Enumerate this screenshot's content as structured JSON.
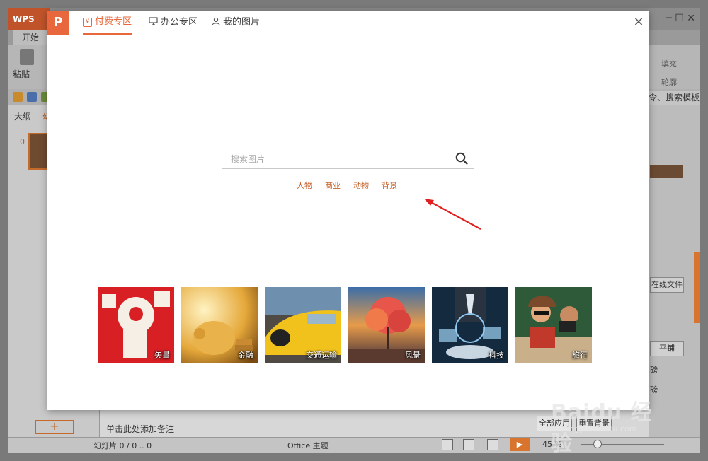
{
  "app": {
    "logo": "WPS",
    "tab_start": "开始",
    "paste_label": "粘贴",
    "left_tab_outline": "大纲",
    "left_tab_slide": "幻",
    "slide_num": "0",
    "add_slide": "+",
    "notes_placeholder": "单击此处添加备注",
    "status_slide": "幻灯片 0 / 0 .. 0",
    "status_theme": "Office 主题",
    "zoom": "45 %",
    "right_fill": "填充",
    "right_outline": "轮廓",
    "right_search_template": "令、搜索模板",
    "right_online_file": "在线文件",
    "right_tile": "平铺",
    "right_pound_1": "磅",
    "right_pound_2": "磅",
    "btn_apply_all": "全部应用",
    "btn_reset_bg": "重置背景",
    "win_controls": "─  ☐  ✕"
  },
  "dialog": {
    "logo": "P",
    "tabs": [
      {
        "label": "付费专区",
        "icon": "yen-icon",
        "active": true
      },
      {
        "label": "办公专区",
        "icon": "monitor-icon",
        "active": false
      },
      {
        "label": "我的图片",
        "icon": "user-icon",
        "active": false
      }
    ],
    "close": "×",
    "search": {
      "placeholder": "搜索图片",
      "value": ""
    },
    "hot_tags": [
      "人物",
      "商业",
      "动物",
      "背景"
    ],
    "categories": [
      {
        "label": "矢量"
      },
      {
        "label": "金融"
      },
      {
        "label": "交通运输"
      },
      {
        "label": "风景"
      },
      {
        "label": "科技"
      },
      {
        "label": "旅行"
      }
    ]
  },
  "watermark": {
    "text": "Baidu 经验",
    "sub": "jingyan.baidu.com"
  },
  "colors": {
    "accent": "#e8673c",
    "tag": "#c5622a",
    "arrow": "#e02020"
  }
}
